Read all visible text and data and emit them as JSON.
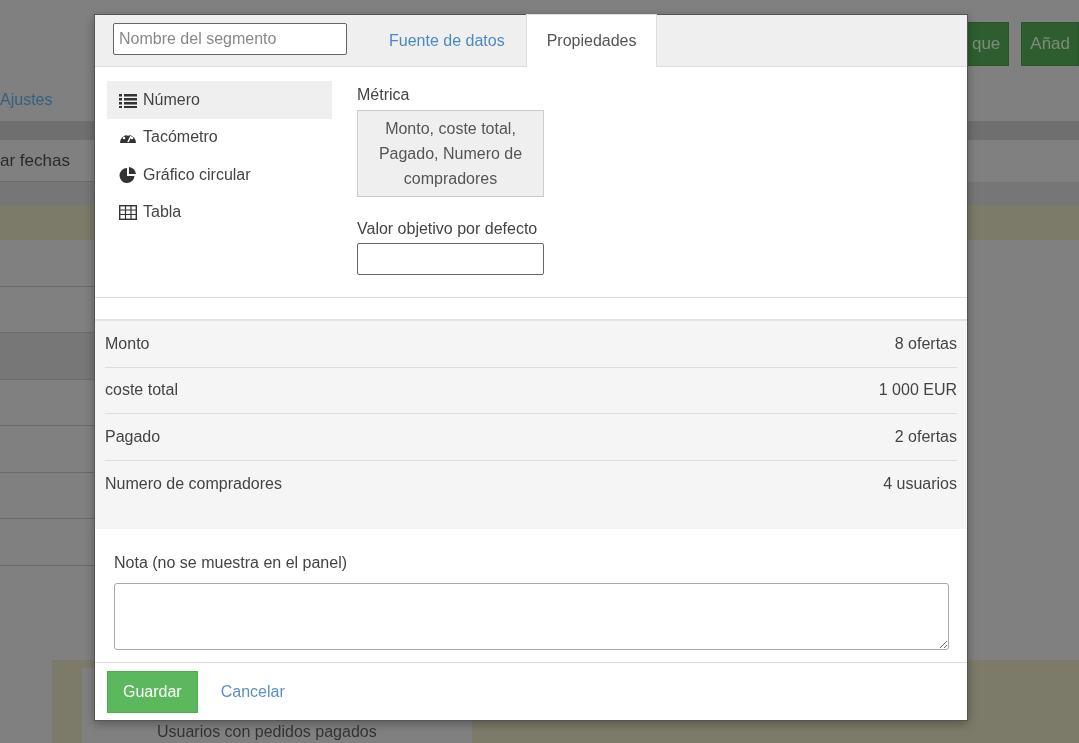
{
  "background": {
    "header_buttons": [
      "que",
      "Añad"
    ],
    "settings_link": "Ajustes",
    "date_button": "ar fechas",
    "bottom_text": "Usuarios con pedidos pagados"
  },
  "modal": {
    "name_field": {
      "placeholder": "Nombre del segmento"
    },
    "tabs": [
      {
        "label": "Fuente de datos",
        "selected": false
      },
      {
        "label": "Propiedades",
        "selected": true
      }
    ],
    "chart_types": [
      {
        "label": "Número",
        "kind": "list",
        "selected": true
      },
      {
        "label": "Tacómetro",
        "kind": "gauge",
        "selected": false
      },
      {
        "label": "Gráfico circular",
        "kind": "pie",
        "selected": false
      },
      {
        "label": "Tabla",
        "kind": "table",
        "selected": false
      }
    ],
    "metric_label": "Métrica",
    "metric_value": "Monto, coste total, Pagado, Numero de compradores",
    "target_label": "Valor objetivo por defecto",
    "summary": [
      {
        "name": "Monto",
        "value": "8 ofertas"
      },
      {
        "name": "coste total",
        "value": "1 000 EUR"
      },
      {
        "name": "Pagado",
        "value": "2 ofertas"
      },
      {
        "name": "Numero de compradores",
        "value": "4 usuarios"
      }
    ],
    "note_label": "Nota (no se muestra en el panel)",
    "save_button": "Guardar",
    "cancel_link": "Cancelar"
  }
}
